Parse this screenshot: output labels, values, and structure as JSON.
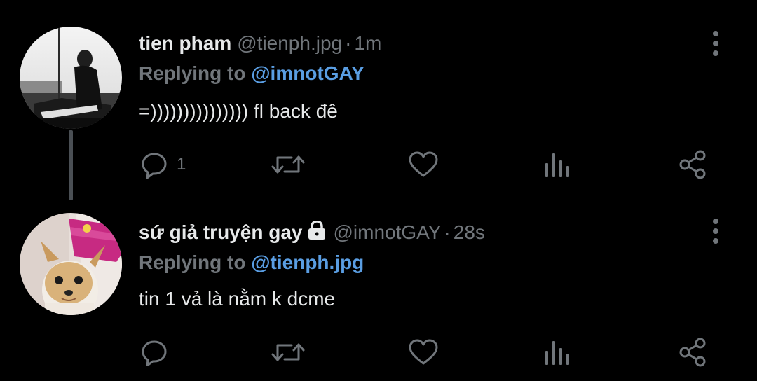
{
  "tweets": [
    {
      "name": "tien pham",
      "handle": "@tienph.jpg",
      "separator": "·",
      "time": "1m",
      "replying_prefix": "Replying to",
      "replying_to": "@imnotGAY",
      "text": "=))))))))))))))) fl back đê",
      "reply_count": "1",
      "protected": false
    },
    {
      "name": "sứ giả truyện gay",
      "handle": "@imnotGAY",
      "separator": "·",
      "time": "28s",
      "replying_prefix": "Replying to",
      "replying_to": "@tienph.jpg",
      "text": "tin 1 vả là nằm k dcme",
      "reply_count": "",
      "protected": true
    }
  ],
  "icons": {
    "reply": "speech-bubble",
    "retweet": "retweet-arrows",
    "like": "heart-outline",
    "views": "bar-chart",
    "share": "share-nodes",
    "more": "vertical-ellipsis",
    "protected": "lock"
  },
  "colors": {
    "background": "#000000",
    "text_primary": "#e7e9ea",
    "text_secondary": "#71767b",
    "mention": "#5a9ee3",
    "thread_line": "#4a4f54"
  }
}
